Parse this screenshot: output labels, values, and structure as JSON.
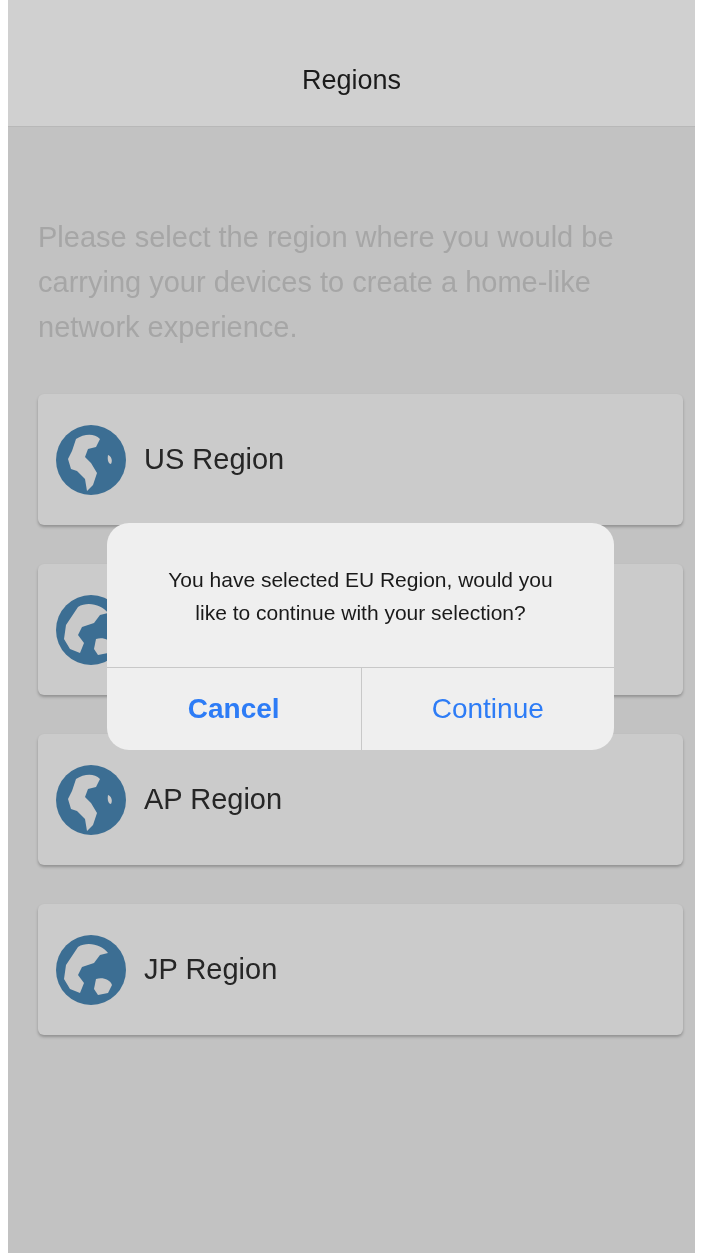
{
  "header": {
    "title": "Regions"
  },
  "instructions": "Please select the region where you would be carrying your devices  to create a home-like network experience.",
  "regions": [
    {
      "kind": "labeled",
      "label": "US Region"
    },
    {
      "kind": "covered"
    },
    {
      "kind": "labeled",
      "label": "AP Region"
    },
    {
      "kind": "labeled",
      "label": "JP Region"
    }
  ],
  "dialog": {
    "message": "You have selected EU Region, would you like to continue with your selection?",
    "buttons": [
      {
        "label": "Cancel",
        "kind": "cancel"
      },
      {
        "label": "Continue",
        "kind": "confirm"
      }
    ]
  }
}
